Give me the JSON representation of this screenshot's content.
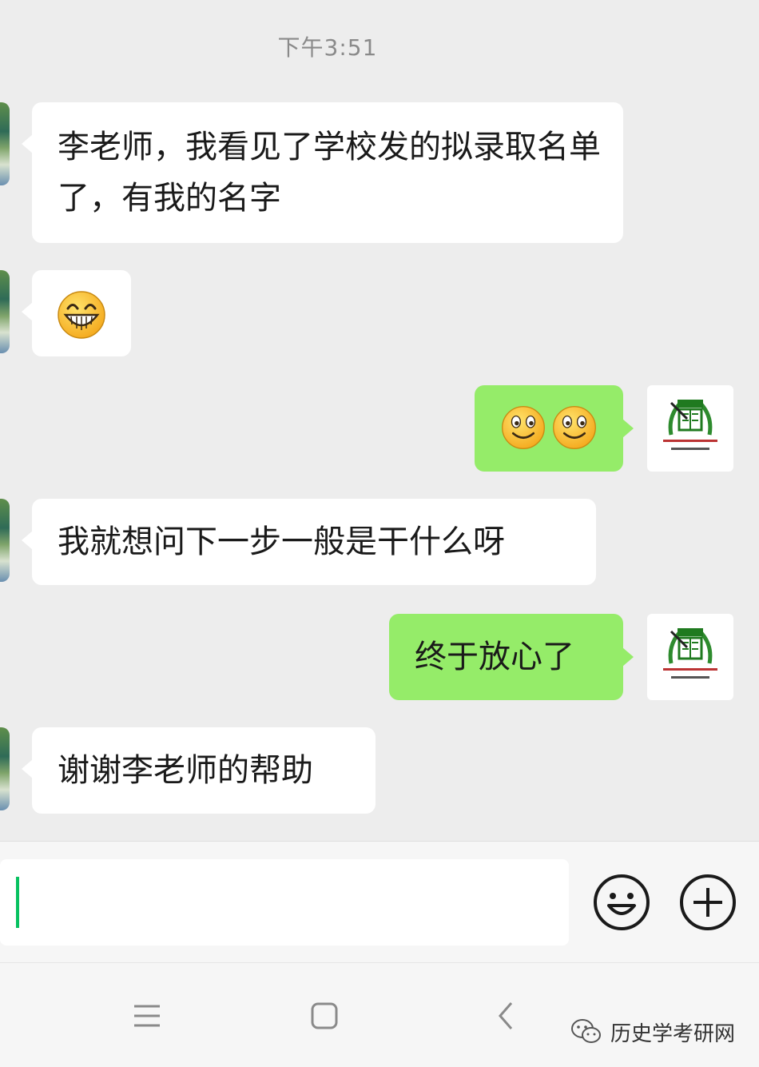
{
  "status": {
    "timestamp": "下午3:51"
  },
  "messages": [
    {
      "side": "left",
      "type": "text",
      "text": "李老师，我看见了学校发的拟录取名单了，有我的名字"
    },
    {
      "side": "left",
      "type": "emoji",
      "emoji": "grin-emoji"
    },
    {
      "side": "right",
      "type": "emoji",
      "emoji": "smile-emoji x2"
    },
    {
      "side": "left",
      "type": "text",
      "text": "我就想问下一步一般是干什么呀"
    },
    {
      "side": "right",
      "type": "text",
      "text": "终于放心了"
    },
    {
      "side": "left",
      "type": "text",
      "text": "谢谢李老师的帮助"
    }
  ],
  "input": {
    "value": "",
    "icons": [
      "emoji-face-icon",
      "plus-circle-icon"
    ]
  },
  "nav": {
    "icons": [
      "menu-icon",
      "home-square-icon",
      "back-chevron-icon"
    ]
  },
  "watermark": {
    "text": "历史学考研网"
  },
  "colors": {
    "incoming": "#ffffff",
    "outgoing": "#95ec69",
    "background": "#ededed",
    "cursor": "#07c160"
  }
}
